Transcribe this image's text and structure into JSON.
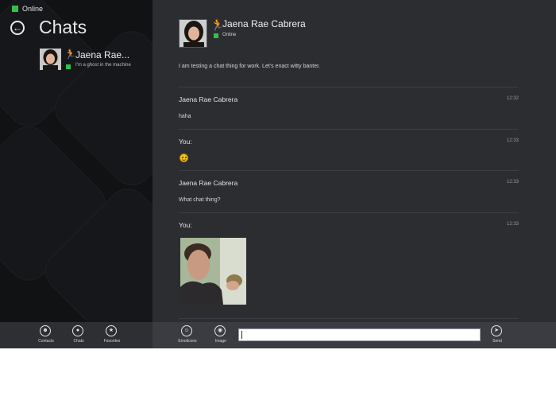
{
  "window": {
    "status": "Online"
  },
  "left_pane": {
    "title": "Chats",
    "chats": [
      {
        "name": "Jaena Rae...",
        "snippet": "I'm a ghost in the machine"
      }
    ]
  },
  "conversation": {
    "contact_name": "Jaena Rae Cabrera",
    "contact_status": "Online",
    "intro": "I am testing a chat thing for work. Let's enact witty banter.",
    "messages": [
      {
        "sender": "Jaena Rae Cabrera",
        "time": "12:32",
        "text": "haha"
      },
      {
        "sender": "You:",
        "time": "12:33",
        "text": "",
        "attachment": "smiley-emoticon"
      },
      {
        "sender": "Jaena Rae Cabrera",
        "time": "12:33",
        "text": "What chat thing?"
      },
      {
        "sender": "You:",
        "time": "12:33",
        "text": "",
        "attachment": "photo"
      }
    ]
  },
  "appbar": {
    "left_buttons": [
      {
        "label": "Contacts",
        "icon": "contacts-icon"
      },
      {
        "label": "Chats",
        "icon": "chats-icon"
      },
      {
        "label": "Favorites",
        "icon": "star-icon"
      }
    ],
    "right_buttons": [
      {
        "label": "Emoticons",
        "icon": "emoticon-icon"
      },
      {
        "label": "Image",
        "icon": "camera-icon"
      }
    ],
    "send_label": "Send",
    "input_value": ""
  },
  "colors": {
    "online": "#33c04a",
    "accent": "#f29a1b",
    "left_bg": "#111214",
    "right_bg": "#2b2d31"
  }
}
